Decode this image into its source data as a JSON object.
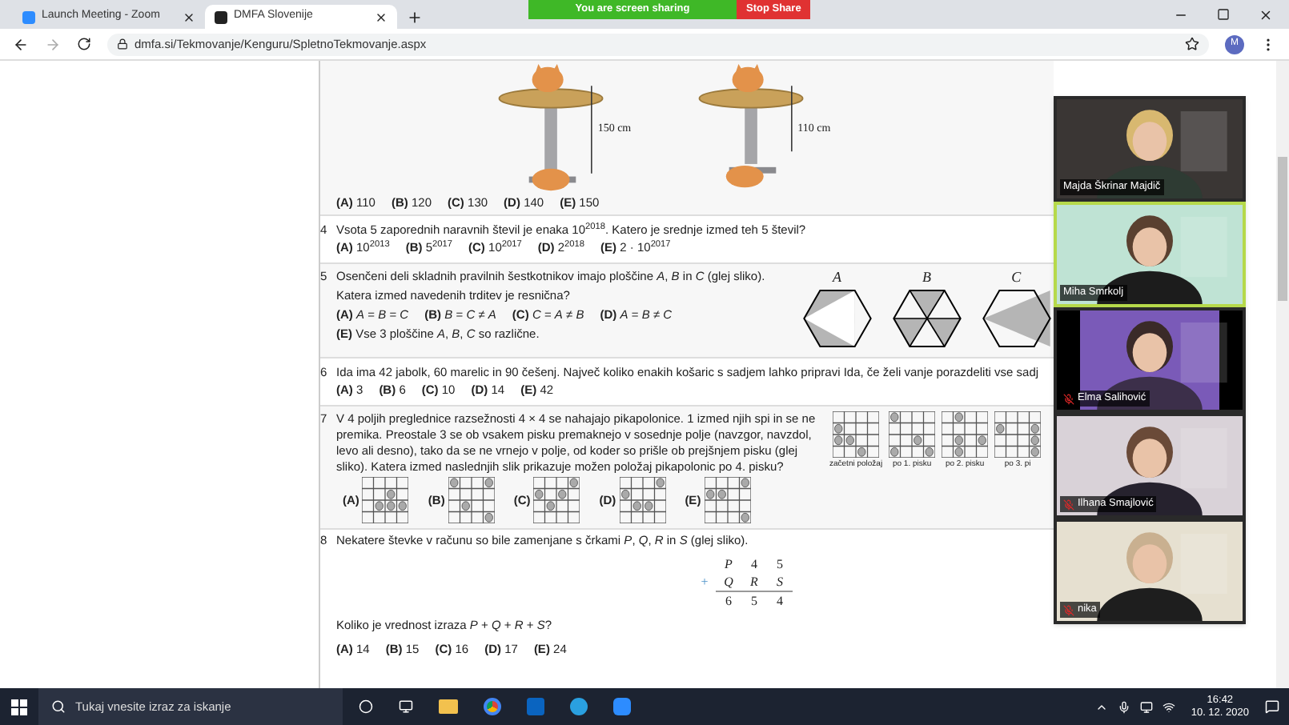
{
  "browser": {
    "tabs": [
      {
        "title": "Launch Meeting - Zoom",
        "selected": false
      },
      {
        "title": "DMFA Slovenije",
        "selected": true
      }
    ],
    "address": "dmfa.si/Tekmovanje/Kenguru/SpletnoTekmovanje.aspx",
    "profile": "M"
  },
  "share_banner": {
    "status": "You are screen sharing",
    "stop": "Stop Share"
  },
  "questions": [
    {
      "kind": "tables",
      "heights": [
        "150 cm",
        "110 cm"
      ],
      "answers": [
        {
          "label": "(A)",
          "value": "110"
        },
        {
          "label": "(B)",
          "value": "120"
        },
        {
          "label": "(C)",
          "value": "130"
        },
        {
          "label": "(D)",
          "value": "140"
        },
        {
          "label": "(E)",
          "value": "150"
        }
      ]
    },
    {
      "kind": "plain",
      "number": "4",
      "lines": [
        "Vsota 5 zaporednih naravnih števil je enaka 10$^{2018}$. Katero je srednje izmed teh 5 števil?"
      ],
      "answers": [
        {
          "label": "(A)",
          "value": "10$^{2013}$"
        },
        {
          "label": "(B)",
          "value": "5$^{2017}$"
        },
        {
          "label": "(C)",
          "value": "10$^{2017}$"
        },
        {
          "label": "(D)",
          "value": "2$^{2018}$"
        },
        {
          "label": "(E)",
          "value": "2 · 10$^{2017}$"
        }
      ]
    },
    {
      "kind": "hexagons",
      "number": "5",
      "lines": [
        "Osenčeni deli skladnih pravilnih šestkotnikov imajo ploščine *A*, *B* in *C* (glej sliko).",
        "Katera izmed navedenih trditev je resnična?"
      ],
      "figure_labels": [
        "A",
        "B",
        "C"
      ],
      "answers": [
        {
          "label": "(A)",
          "value": "*A* = *B* = *C*"
        },
        {
          "label": "(B)",
          "value": "*B* = *C* ≠ *A*"
        },
        {
          "label": "(C)",
          "value": "*C* = *A* ≠ *B*"
        },
        {
          "label": "(D)",
          "value": "*A* = *B* ≠ *C*"
        },
        {
          "label": "(E)",
          "value": "Vse 3 ploščine *A*, *B*, *C* so različne."
        }
      ]
    },
    {
      "kind": "plain",
      "number": "6",
      "lines": [
        "Ida ima 42 jabolk, 60 marelic in 90 češenj. Največ koliko enakih košaric s sadjem lahko pripravi Ida, če želi vanje porazdeliti vse sadj"
      ],
      "answers": [
        {
          "label": "(A)",
          "value": "3"
        },
        {
          "label": "(B)",
          "value": "6"
        },
        {
          "label": "(C)",
          "value": "10"
        },
        {
          "label": "(D)",
          "value": "14"
        },
        {
          "label": "(E)",
          "value": "42"
        }
      ]
    },
    {
      "kind": "grids",
      "number": "7",
      "lines": [
        "V 4 poljih preglednice razsežnosti 4 × 4 se nahajajo pikapolonice. 1 izmed njih spi in se ne premika. Preostale 3 se ob vsakem pisku premaknejo v sosednje polje (navzgor, navzdol, levo ali desno), tako da se ne vrnejo v polje, od koder so prišle ob prejšnjem pisku (glej sliko). Katera izmed naslednjih slik prikazuje možen položaj pikapolonic po 4. pisku?"
      ],
      "figure_labels": [
        "začetni položaj",
        "po 1. pisku",
        "po 2. pisku",
        "po 3. pi"
      ],
      "answers": [
        {
          "label": "(A)"
        },
        {
          "label": "(B)"
        },
        {
          "label": "(C)"
        },
        {
          "label": "(D)"
        },
        {
          "label": "(E)"
        }
      ]
    },
    {
      "kind": "sum",
      "number": "8",
      "lines": [
        "Nekatere števke v računu so bile zamenjane s črkami *P*, *Q*, *R* in *S* (glej sliko)."
      ],
      "sum": {
        "sign": "+",
        "rows": [
          [
            "P",
            "4",
            "5"
          ],
          [
            "Q",
            "R",
            "S"
          ],
          [
            "6",
            "5",
            "4"
          ]
        ]
      },
      "question": "Koliko je vrednost izraza *P* + *Q* + *R* + *S*?",
      "answers": [
        {
          "label": "(A)",
          "value": "14"
        },
        {
          "label": "(B)",
          "value": "15"
        },
        {
          "label": "(C)",
          "value": "16"
        },
        {
          "label": "(D)",
          "value": "17"
        },
        {
          "label": "(E)",
          "value": "24"
        }
      ]
    }
  ],
  "participants": [
    {
      "name": "Majda Škrinar Majdič",
      "muted": false,
      "selected": false
    },
    {
      "name": "Miha Smrkolj",
      "muted": false,
      "selected": true
    },
    {
      "name": "Elma Salihović",
      "muted": true,
      "selected": false
    },
    {
      "name": "Ilhana Smajlović",
      "muted": true,
      "selected": false
    },
    {
      "name": "nika",
      "muted": true,
      "selected": false
    }
  ],
  "taskbar": {
    "search_placeholder": "Tukaj vnesite izraz za iskanje",
    "time": "16:42",
    "date": "10. 12. 2020"
  }
}
